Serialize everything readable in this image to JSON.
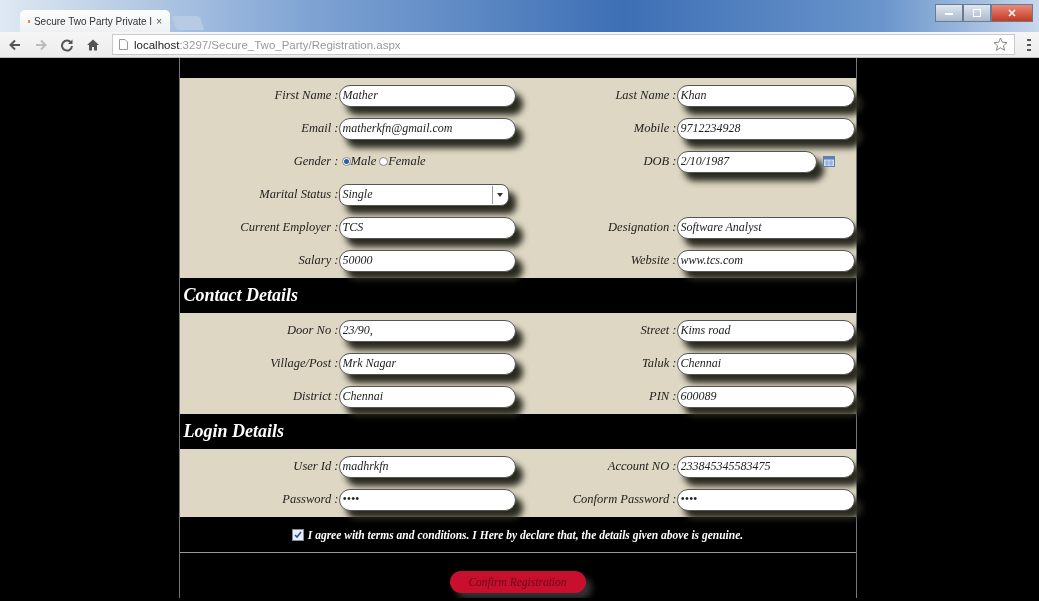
{
  "browser": {
    "tab_title": "Secure Two Party Private I",
    "tab_close": "×",
    "url_host": "localhost",
    "url_path": ":3297/Secure_Two_Party/Registration.aspx"
  },
  "sections": [
    {
      "rows": [
        [
          {
            "kind": "text",
            "label": "First Name :",
            "value": "Mather"
          },
          {
            "kind": "text",
            "label": "Last Name :",
            "value": "Khan"
          }
        ],
        [
          {
            "kind": "text",
            "label": "Email :",
            "value": "matherkfn@gmail.com"
          },
          {
            "kind": "text",
            "label": "Mobile :",
            "value": "9712234928"
          }
        ],
        [
          {
            "kind": "radio",
            "label": "Gender :",
            "options": [
              {
                "label": "Male",
                "selected": true
              },
              {
                "label": "Female",
                "selected": false
              }
            ]
          },
          {
            "kind": "date",
            "label": "DOB :",
            "value": "2/10/1987"
          }
        ],
        [
          {
            "kind": "select",
            "label": "Marital Status :",
            "value": "Single"
          },
          {
            "kind": "empty"
          }
        ],
        [
          {
            "kind": "text",
            "label": "Current Employer :",
            "value": "TCS"
          },
          {
            "kind": "text",
            "label": "Designation :",
            "value": "Software Analyst"
          }
        ],
        [
          {
            "kind": "text",
            "label": "Salary :",
            "value": "50000"
          },
          {
            "kind": "text",
            "label": "Website :",
            "value": "www.tcs.com"
          }
        ]
      ]
    },
    {
      "title": "Contact Details",
      "rows": [
        [
          {
            "kind": "text",
            "label": "Door No :",
            "value": "23/90,"
          },
          {
            "kind": "text",
            "label": "Street :",
            "value": "Kims road"
          }
        ],
        [
          {
            "kind": "text",
            "label": "Village/Post :",
            "value": "Mrk Nagar"
          },
          {
            "kind": "text",
            "label": "Taluk :",
            "value": "Chennai"
          }
        ],
        [
          {
            "kind": "text",
            "label": "District :",
            "value": "Chennai"
          },
          {
            "kind": "text",
            "label": "PIN :",
            "value": "600089"
          }
        ]
      ]
    },
    {
      "title": "Login Details",
      "rows": [
        [
          {
            "kind": "text",
            "label": "User Id :",
            "value": "madhrkfn"
          },
          {
            "kind": "text",
            "label": "Account NO :",
            "value": "233845345583475"
          }
        ],
        [
          {
            "kind": "text",
            "label": "Password :",
            "value": "••••"
          },
          {
            "kind": "text",
            "label": "Conform Password :",
            "value": "••••"
          }
        ]
      ]
    }
  ],
  "agree": {
    "checked": true,
    "text": "I agree with terms and conditions. I Here by declare that, the details given above is genuine."
  },
  "submit": "Confirm Registration"
}
